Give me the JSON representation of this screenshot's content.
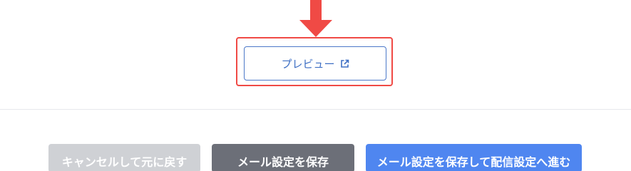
{
  "annotation": {
    "arrow_color": "#f04a45",
    "highlight_color": "#f04a45"
  },
  "preview": {
    "label": "プレビュー",
    "icon": "external-link-icon",
    "color": "#3e6fc4"
  },
  "footer": {
    "cancel_label": "キャンセルして元に戻す",
    "save_label": "メール設定を保存",
    "save_next_label": "メール設定を保存して配信設定へ進む",
    "cancel_color": "#cfd1d5",
    "save_color": "#6c6f78",
    "save_next_color": "#4f86f0"
  }
}
